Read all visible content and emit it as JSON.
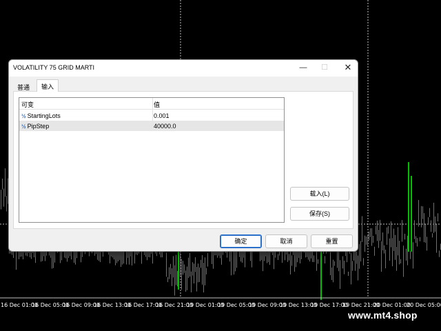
{
  "chart": {
    "time_labels": [
      "16 Dec 01:00",
      "16 Dec 05:00",
      "16 Dec 09:00",
      "16 Dec 13:00",
      "16 Dec 17:00",
      "16 Dec 21:00",
      "19 Dec 01:00",
      "19 Dec 05:00",
      "19 Dec 09:00",
      "19 Dec 13:00",
      "19 Dec 17:00",
      "19 Dec 21:00",
      "20 Dec 01:00",
      "20 Dec 05:00"
    ],
    "candle_color": "#00c000",
    "grid_color": "#c0c0c0",
    "background": "#000000"
  },
  "watermark": "www.mt4.shop",
  "dialog": {
    "title": "VOLATILITY 75 GRID MARTI",
    "window_controls": {
      "minimize": "—",
      "maximize": "☐",
      "close": "✕"
    },
    "tabs": [
      {
        "label": "普通",
        "active": false
      },
      {
        "label": "输入",
        "active": true
      }
    ],
    "grid": {
      "headers": [
        "可变",
        "值"
      ],
      "rows": [
        {
          "icon": "½",
          "name": "StartingLots",
          "value": "0.001",
          "selected": false
        },
        {
          "icon": "½",
          "name": "PipStep",
          "value": "40000.0",
          "selected": true
        }
      ]
    },
    "side_buttons": {
      "load": "载入(L)",
      "save": "保存(S)"
    },
    "footer_buttons": {
      "ok": "确定",
      "cancel": "取消",
      "reset": "重置"
    },
    "accent_color": "#2a6fc9"
  }
}
